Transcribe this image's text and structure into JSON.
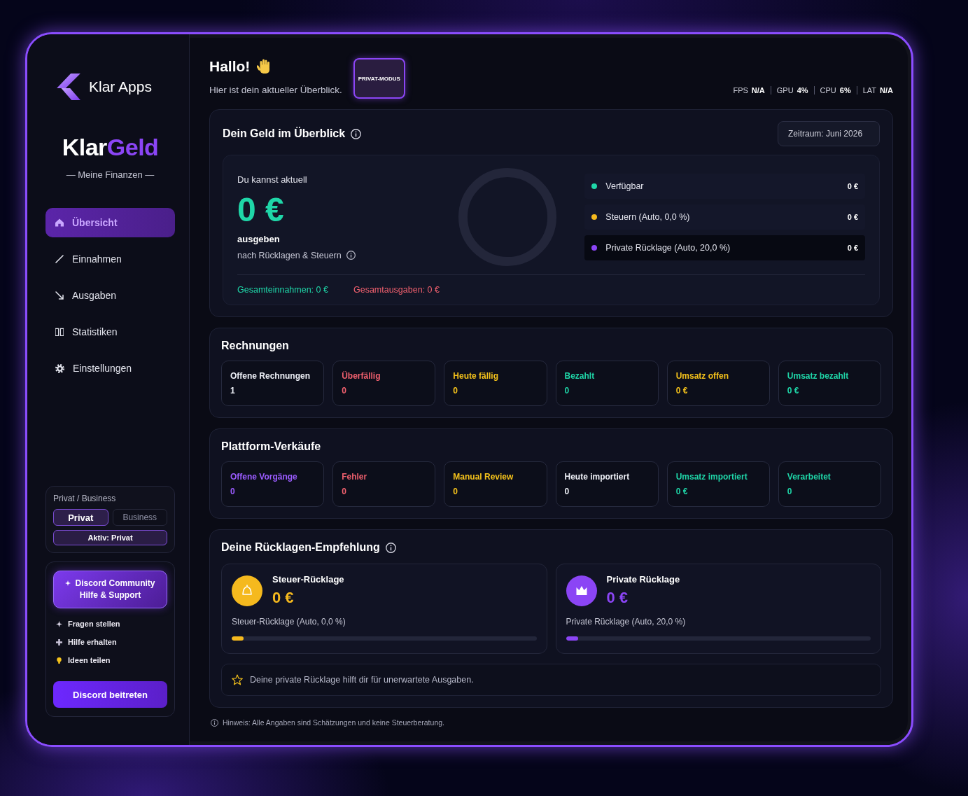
{
  "sidebar": {
    "brand": "Klar Apps",
    "app_title": {
      "first": "Klar",
      "second": "Geld"
    },
    "tagline": "— Meine Finanzen —",
    "nav": [
      {
        "label": "Übersicht",
        "kind": "home",
        "selected": true
      },
      {
        "label": "Einnahmen",
        "kind": "income",
        "selected": false
      },
      {
        "label": "Ausgaben",
        "kind": "expenses",
        "selected": false
      },
      {
        "label": "Statistiken",
        "kind": "stats",
        "selected": false
      },
      {
        "label": "Einstellungen",
        "kind": "settings",
        "selected": false
      }
    ],
    "mode_switch": {
      "label": "Privat / Business",
      "options": [
        {
          "label": "Privat",
          "selected": true
        },
        {
          "label": "Business",
          "selected": false
        }
      ],
      "status": "Aktiv: Privat"
    },
    "community": {
      "banner_lines": [
        "Discord Community",
        "Hilfe & Support"
      ],
      "items": [
        {
          "kind": "question",
          "label": "Fragen stellen"
        },
        {
          "kind": "help",
          "label": "Hilfe erhalten"
        },
        {
          "kind": "idea",
          "label": "Ideen teilen"
        }
      ],
      "button": "Discord beitreten"
    }
  },
  "header": {
    "greeting": "Hallo!",
    "subtitle": "Hier ist dein aktueller Überblick.",
    "mode_badge": "PRIVAT-MODUS",
    "stats": [
      {
        "label": "FPS",
        "value": "N/A"
      },
      {
        "label": "GPU",
        "value": "4%"
      },
      {
        "label": "CPU",
        "value": "6%"
      },
      {
        "label": "LAT",
        "value": "N/A"
      }
    ]
  },
  "overview": {
    "title": "Dein Geld im Überblick",
    "period": "Zeitraum: Juni 2026",
    "intro": "Du kannst aktuell",
    "amount": "0 €",
    "verb": "ausgeben",
    "note": "nach Rücklagen & Steuern",
    "legend": [
      {
        "label": "Verfügbar",
        "amount": "0 €",
        "color": "#1fd6a8",
        "highlighted": false
      },
      {
        "label": "Steuern (Auto, 0,0 %)",
        "amount": "0 €",
        "color": "#f5b91e",
        "highlighted": false
      },
      {
        "label": "Private Rücklage (Auto, 20,0 %)",
        "amount": "0 €",
        "color": "#8b45f5",
        "highlighted": true
      }
    ],
    "totals": [
      {
        "kind": "income",
        "text": "Gesamteinnahmen: 0 €"
      },
      {
        "kind": "expense",
        "text": "Gesamtausgaben: 0 €"
      }
    ]
  },
  "invoices": {
    "title": "Rechnungen",
    "tiles": [
      {
        "label": "Offene Rechnungen",
        "value": "1",
        "color": "#eef0f7"
      },
      {
        "label": "Überfällig",
        "value": "0",
        "color": "#f0606e"
      },
      {
        "label": "Heute fällig",
        "value": "0",
        "color": "#f5c21b"
      },
      {
        "label": "Bezahlt",
        "value": "0",
        "color": "#1fd6a8"
      },
      {
        "label": "Umsatz offen",
        "value": "0 €",
        "color": "#f5c21b"
      },
      {
        "label": "Umsatz bezahlt",
        "value": "0 €",
        "color": "#1fd6a8"
      }
    ]
  },
  "platform_sales": {
    "title": "Plattform-Verkäufe",
    "tiles": [
      {
        "label": "Offene Vorgänge",
        "value": "0",
        "color": "#9b5cff"
      },
      {
        "label": "Fehler",
        "value": "0",
        "color": "#f0606e"
      },
      {
        "label": "Manual Review",
        "value": "0",
        "color": "#f5c21b"
      },
      {
        "label": "Heute importiert",
        "value": "0",
        "color": "#eef0f7"
      },
      {
        "label": "Umsatz importiert",
        "value": "0 €",
        "color": "#1fd6a8"
      },
      {
        "label": "Verarbeitet",
        "value": "0",
        "color": "#1fd6a8"
      }
    ]
  },
  "reserves": {
    "title": "Deine Rücklagen-Empfehlung",
    "cards": [
      {
        "kind": "tax",
        "title": "Steuer-Rücklage",
        "amount": "0 €",
        "caption": "Steuer-Rücklage (Auto, 0,0 %)",
        "level": 0.04,
        "color": "#f5b91e"
      },
      {
        "kind": "private",
        "title": "Private Rücklage",
        "amount": "0 €",
        "caption": "Private Rücklage (Auto, 20,0 %)",
        "level": 0.04,
        "color": "#8b45f5"
      }
    ],
    "tip": "Deine private Rücklage hilft dir für unerwartete Ausgaben."
  },
  "footer_note": "Hinweis: Alle Angaben sind Schätzungen und keine Steuerberatung."
}
